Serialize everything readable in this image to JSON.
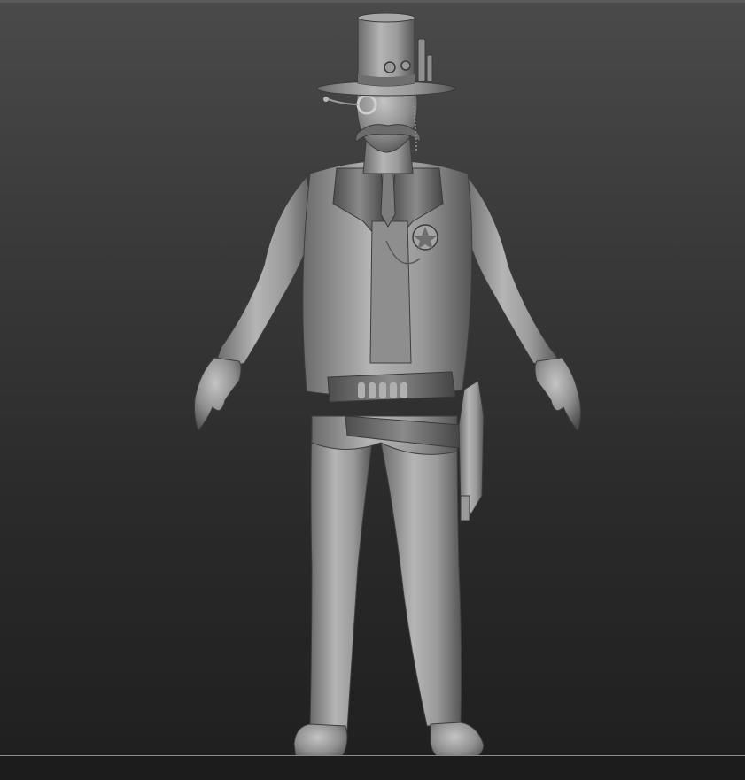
{
  "viewport": {
    "background_top": "#4a4a4a",
    "background_bottom": "#1f1f1f",
    "floor_color": "#8a8a8a"
  },
  "model": {
    "material_light": "#b8b8b8",
    "material_mid": "#8c8c8c",
    "material_dark": "#4e4e4e"
  }
}
